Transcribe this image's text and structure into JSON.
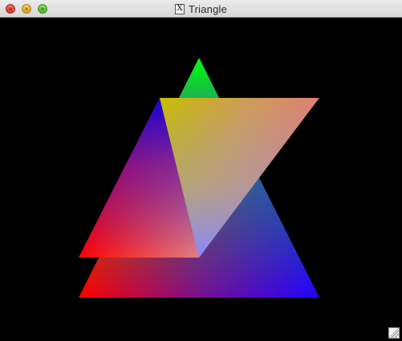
{
  "window": {
    "title": "Triangle",
    "title_icon": "X",
    "icon_name": "x11-app-icon",
    "background": "#000000"
  },
  "controls": {
    "close": "close-button",
    "minimize": "minimize-button",
    "zoom": "zoom-button"
  },
  "scene": {
    "back_triangle_colors": [
      "#00ff00",
      "#ff0000",
      "#2200ff"
    ],
    "front_triangle_colors": [
      "#ccbb00",
      "#dd7070",
      "#8888ff"
    ],
    "upper_triangle_colors": [
      "#0000dd",
      "#ff0000",
      "#ee9999"
    ]
  }
}
